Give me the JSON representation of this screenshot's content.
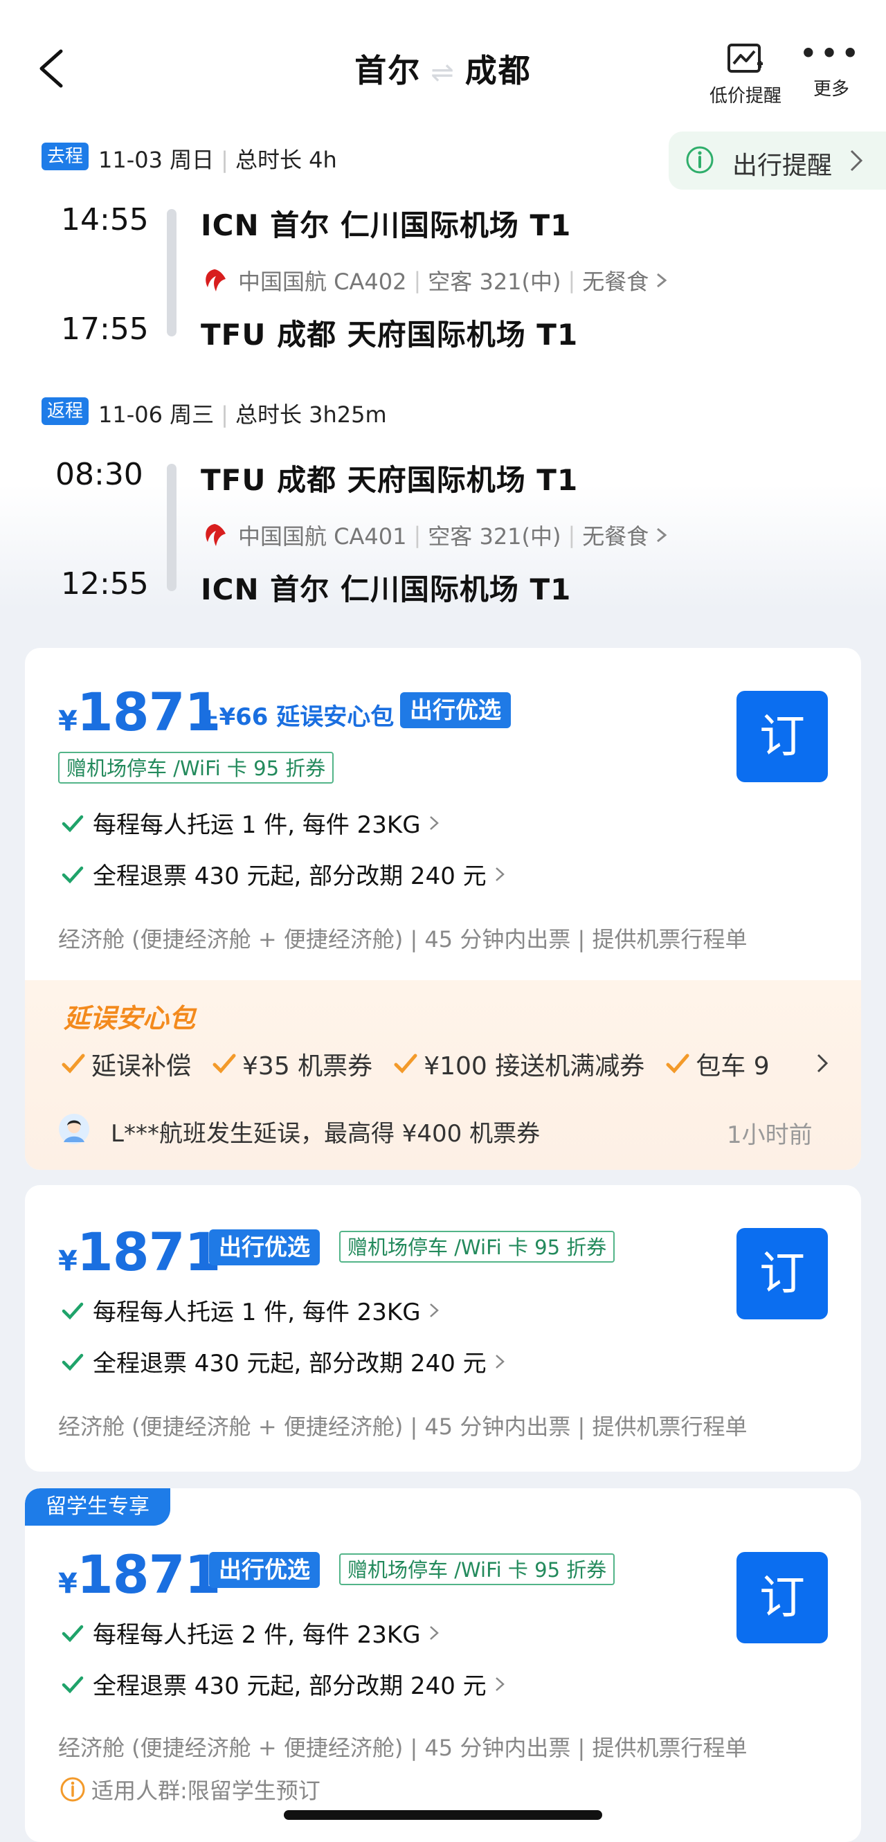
{
  "header": {
    "title_from": "首尔",
    "title_swap": "⇌",
    "title_to": "成都",
    "price_alert_label": "低价提醒",
    "more_label": "更多"
  },
  "outbound": {
    "tag": "去程",
    "date": "11-03 周日",
    "duration": "总时长 4h",
    "dep_time": "14:55",
    "dep_airport": "ICN  首尔 仁川国际机场 T1",
    "airline": "中国国航 CA402",
    "aircraft": "空客 321(中)",
    "meal": "无餐食",
    "arr_time": "17:55",
    "arr_airport": "TFU  成都 天府国际机场 T1"
  },
  "travel_tip": {
    "label": "出行提醒"
  },
  "return": {
    "tag": "返程",
    "date": "11-06 周三",
    "duration": "总时长 3h25m",
    "dep_time": "08:30",
    "dep_airport": "TFU  成都 天府国际机场 T1",
    "airline": "中国国航 CA401",
    "aircraft": "空客 321(中)",
    "meal": "无餐食",
    "arr_time": "12:55",
    "arr_airport": "ICN  首尔 仁川国际机场 T1"
  },
  "card1": {
    "currency": "¥",
    "price": "1871",
    "addon": "+¥66 延误安心包",
    "badge": "出行优选",
    "promo": "赠机场停车 /WiFi 卡 95 折券",
    "baggage": "每程每人托运 1 件, 每件 23KG",
    "refund": "全程退票 430 元起, 部分改期 240 元",
    "cabin": "经济舱 (便捷经济舱 + 便捷经济舱) | 45 分钟内出票 | 提供机票行程单",
    "book_label": "订",
    "delay_title": "延误安心包",
    "delay_items": [
      "延误补偿",
      "¥35 机票券",
      "¥100 接送机满减券",
      "包车 9"
    ],
    "notice": "L***航班发生延误，最高得 ¥400 机票券",
    "notice_time": "1小时前"
  },
  "card2": {
    "currency": "¥",
    "price": "1871",
    "badge": "出行优选",
    "promo": "赠机场停车 /WiFi 卡 95 折券",
    "baggage": "每程每人托运 1 件, 每件 23KG",
    "refund": "全程退票 430 元起, 部分改期 240 元",
    "cabin": "经济舱 (便捷经济舱 + 便捷经济舱) | 45 分钟内出票 | 提供机票行程单",
    "book_label": "订"
  },
  "card3": {
    "tag": "留学生专享",
    "currency": "¥",
    "price": "1871",
    "badge": "出行优选",
    "promo": "赠机场停车 /WiFi 卡 95 折券",
    "baggage": "每程每人托运 2 件, 每件 23KG",
    "refund": "全程退票 430 元起, 部分改期 240 元",
    "cabin": "经济舱 (便捷经济舱 + 便捷经济舱) | 45 分钟内出票 | 提供机票行程单",
    "applicable": "适用人群:限留学生预订",
    "book_label": "订"
  },
  "colors": {
    "accent": "#1a6fe0",
    "button": "#0b6ef0",
    "orange": "#f38a1d",
    "green_check": "#1fa36a"
  }
}
